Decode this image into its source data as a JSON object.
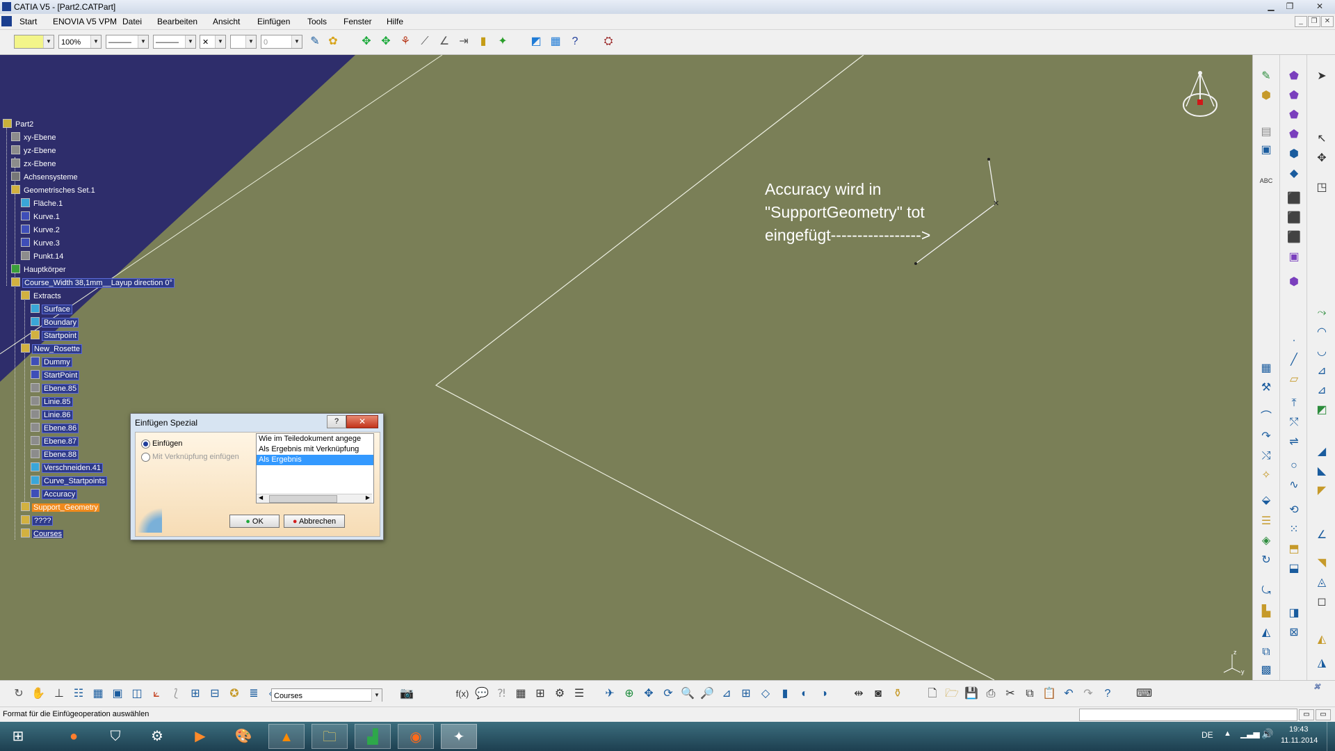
{
  "window": {
    "title": "CATIA V5 - [Part2.CATPart]"
  },
  "menu": {
    "items": [
      "Start",
      "ENOVIA V5 VPM",
      "Datei",
      "Bearbeiten",
      "Ansicht",
      "Einfügen",
      "Tools",
      "Fenster",
      "Hilfe"
    ]
  },
  "toolbar_top": {
    "color_value": "",
    "zoom_value": "100%",
    "line_type_value": "———",
    "line_weight_value": "———",
    "point_symbol_value": "✕",
    "layer_value": "0"
  },
  "tree": {
    "items": [
      "Part2",
      "xy-Ebene",
      "yz-Ebene",
      "zx-Ebene",
      "Achsensysteme",
      "Geometrisches Set.1",
      "Fläche.1",
      "Kurve.1",
      "Kurve.2",
      "Kurve.3",
      "Punkt.14",
      "Hauptkörper",
      "Course_Width 38,1mm__Layup direction 0°",
      "Extracts",
      "Surface",
      "Boundary",
      "Startpoint",
      "New_Rosette",
      "Dummy",
      "StartPoint",
      "Ebene.85",
      "Linie.85",
      "Linie.86",
      "Ebene.86",
      "Ebene.87",
      "Ebene.88",
      "Verschneiden.41",
      "Curve_Startpoints",
      "Accuracy",
      "Support_Geometry",
      "????",
      "Courses"
    ]
  },
  "annotation": {
    "line1": "Accuracy wird in",
    "line2": "\"SupportGeometry\" tot",
    "line3": "eingefügt----------------->"
  },
  "dialog": {
    "title": "Einfügen Spezial",
    "help": "?",
    "radio_paste": "Einfügen",
    "radio_link": "Mit Verknüpfung einfügen",
    "options": [
      "Wie im Teiledokument angege",
      "Als Ergebnis mit Verknüpfung",
      "Als Ergebnis"
    ],
    "ok": "OK",
    "cancel": "Abbrechen"
  },
  "toolbar_bottom": {
    "workbench_combo": "Courses"
  },
  "status": {
    "text": "Format für die Einfügeoperation auswählen"
  },
  "taskbar": {
    "lang": "DE",
    "time": "19:43",
    "date": "11.11.2014"
  }
}
